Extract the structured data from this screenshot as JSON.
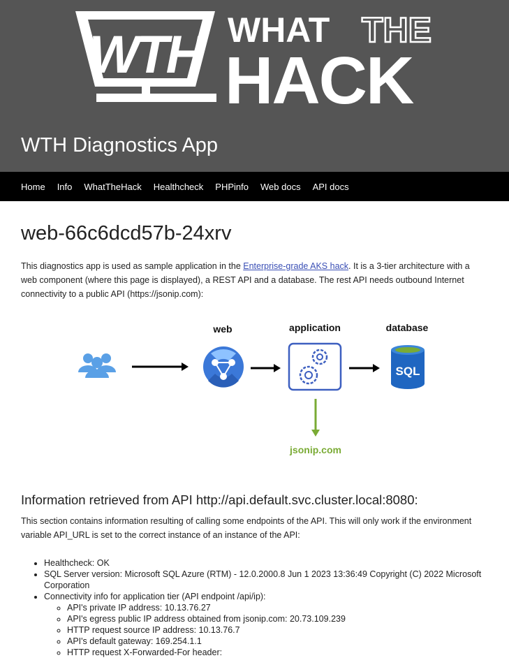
{
  "header": {
    "logo_wth": "WTH",
    "logo_what": "WHAT",
    "logo_the": "THE",
    "logo_hack": "HACK",
    "app_title": "WTH Diagnostics App"
  },
  "nav": [
    "Home",
    "Info",
    "WhatTheHack",
    "Healthcheck",
    "PHPinfo",
    "Web docs",
    "API docs"
  ],
  "main": {
    "hostname": "web-66c6dcd57b-24xrv",
    "intro_prefix": "This diagnostics app is used as sample application in the ",
    "intro_link": "Enterprise-grade AKS hack",
    "intro_suffix": ". It is a 3-tier architecture with a web component (where this page is displayed), a REST API and a database. The rest API needs outbound Internet connectivity to a public API (https://jsonip.com):"
  },
  "diagram": {
    "web_label": "web",
    "application_label": "application",
    "database_label": "database",
    "sql_label": "SQL",
    "jsonip_label": "jsonip.com",
    "colors": {
      "users": "#5aa0e6",
      "web": "#3b78d8",
      "app": "#3d5fc0",
      "db": "#1f66c1",
      "green": "#7aab35"
    }
  },
  "api_section": {
    "heading": "Information retrieved from API http://api.default.svc.cluster.local:8080:",
    "text": "This section contains information resulting of calling some endpoints of the API. This will only work if the environment variable API_URL is set to the correct instance of an instance of the API:",
    "healthcheck": "Healthcheck: OK",
    "sql_version": "SQL Server version: Microsoft SQL Azure (RTM) - 12.0.2000.8 Jun 1 2023 13:36:49 Copyright (C) 2022 Microsoft Corporation",
    "connectivity": "Connectivity info for application tier (API endpoint /api/ip):",
    "sub_items": [
      "API's private IP address: 10.13.76.27",
      "API's egress public IP address obtained from jsonip.com: 20.73.109.239",
      "HTTP request source IP address: 10.13.76.7",
      "API's default gateway: 169.254.1.1",
      "HTTP request X-Forwarded-For header:"
    ]
  }
}
